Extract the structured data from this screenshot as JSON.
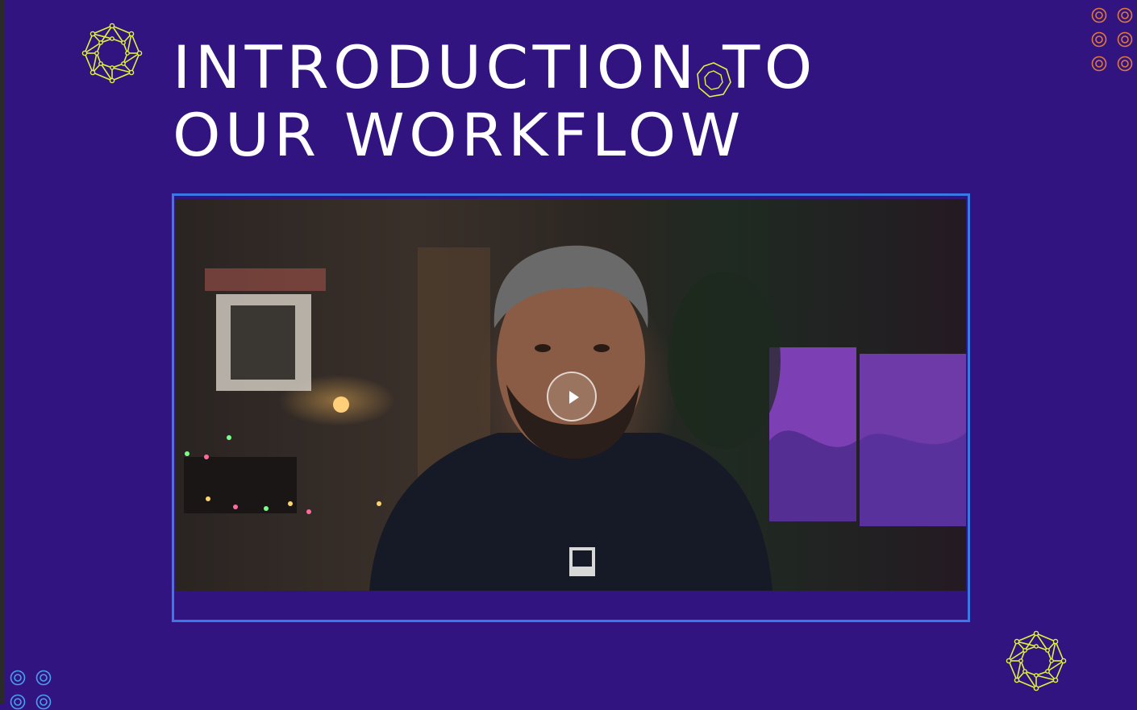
{
  "slide": {
    "title_line_1": "INTRODUCTION TO",
    "title_line_2": "OUR WORKFLOW"
  },
  "colors": {
    "background": "#321480",
    "title": "#ffffff",
    "accent_yellow": "#e3f23a",
    "video_border": "#3a78e6",
    "ring_orange": "#e0783c",
    "ring_blue": "#4aa0f0"
  },
  "video": {
    "play_icon": "play-icon"
  },
  "decorations": {
    "top_left_emblem": "network-octagon-icon",
    "title_hexagon": "hexagon-outline-icon",
    "bottom_right_emblem": "network-octagon-icon",
    "top_right_rings": "concentric-ring-icon",
    "bottom_left_rings": "concentric-ring-icon"
  }
}
